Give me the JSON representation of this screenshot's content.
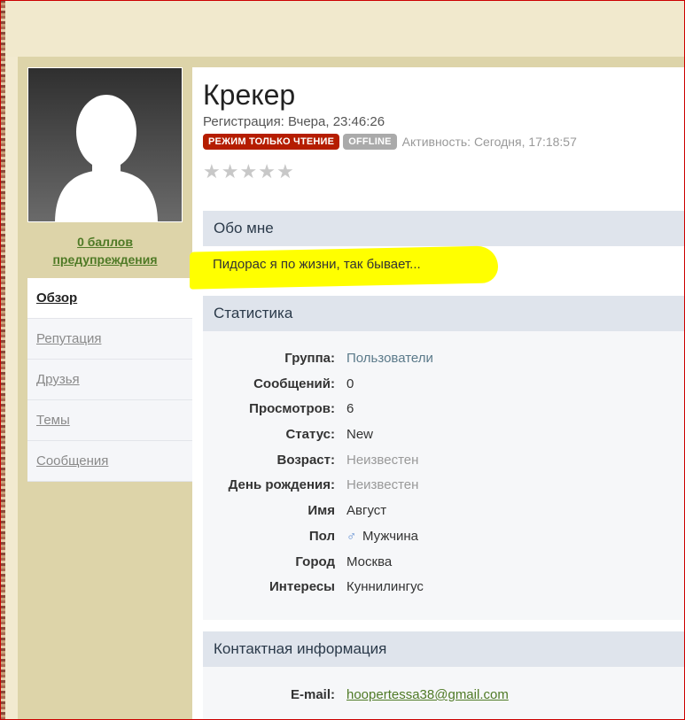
{
  "sidebar": {
    "warnings_line1": "0 баллов",
    "warnings_line2": "предупреждения",
    "nav": [
      "Обзор",
      "Репутация",
      "Друзья",
      "Темы",
      "Сообщения"
    ]
  },
  "profile": {
    "name": "Крекер",
    "registration": "Регистрация: Вчера, 23:46:26",
    "badge_readonly": "РЕЖИМ ТОЛЬКО ЧТЕНИЕ",
    "badge_offline": "OFFLINE",
    "activity": "Активность: Сегодня, 17:18:57",
    "rating_stars": 0
  },
  "about": {
    "title": "Обо мне",
    "text": "Пидорас я по жизни, так бывает..."
  },
  "stats": {
    "title": "Статистика",
    "rows": [
      {
        "label": "Группа:",
        "value": "Пользователи"
      },
      {
        "label": "Сообщений:",
        "value": "0"
      },
      {
        "label": "Просмотров:",
        "value": "6"
      },
      {
        "label": "Статус:",
        "value": "New"
      },
      {
        "label": "Возраст:",
        "value": "Неизвестен"
      },
      {
        "label": "День рождения:",
        "value": "Неизвестен"
      },
      {
        "label": "Имя",
        "value": "Август"
      },
      {
        "label": "Пол",
        "value": "Мужчина"
      },
      {
        "label": "Город",
        "value": "Москва"
      },
      {
        "label": "Интересы",
        "value": "Куннилингус"
      }
    ]
  },
  "contact": {
    "title": "Контактная информация",
    "email_label": "E-mail:",
    "email": "hoopertessa38@gmail.com"
  },
  "icons": {
    "gender": "male-icon",
    "star": "star-icon"
  },
  "colors": {
    "readonly_badge": "#b51d00",
    "offline_badge": "#aaaaaa",
    "link_green": "#4f7a26",
    "section_header": "#dfe4ec"
  }
}
